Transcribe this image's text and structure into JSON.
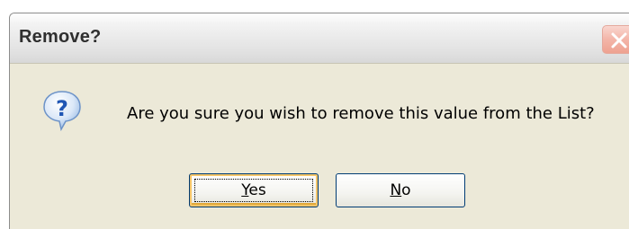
{
  "dialog": {
    "title": "Remove?",
    "message": "Are you sure you wish to remove this value from the List?",
    "icon": "question-icon",
    "close_icon": "close-icon",
    "buttons": {
      "yes": {
        "mnemonic": "Y",
        "rest": "es"
      },
      "no": {
        "mnemonic": "N",
        "rest": "o"
      }
    },
    "default_button": "Yes"
  },
  "colors": {
    "dialog_background": "#ece9d8",
    "button_border": "#003c74",
    "close_button": "#eea190",
    "icon_blue": "#2f6fc9"
  }
}
